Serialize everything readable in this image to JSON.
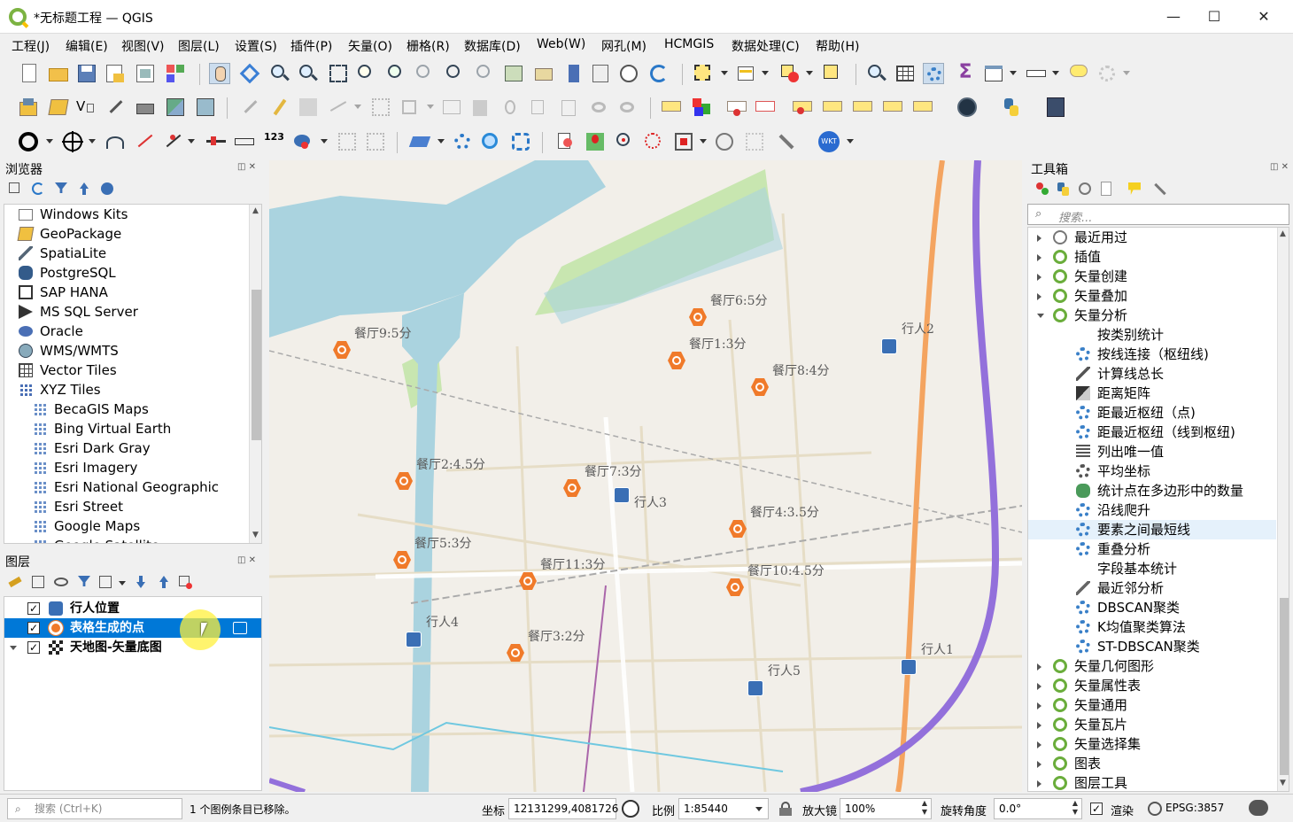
{
  "window": {
    "title": "*无标题工程 — QGIS",
    "min": "—",
    "max": "☐",
    "close": "✕"
  },
  "menu": [
    "工程(J)",
    "编辑(E)",
    "视图(V)",
    "图层(L)",
    "设置(S)",
    "插件(P)",
    "矢量(O)",
    "栅格(R)",
    "数据库(D)",
    "Web(W)",
    "网孔(M)",
    "HCMGIS",
    "数据处理(C)",
    "帮助(H)"
  ],
  "browser": {
    "title": "浏览器",
    "items": [
      {
        "label": "Windows Kits",
        "icon": "folder-icon",
        "expand": "right",
        "indent": 0
      },
      {
        "label": "GeoPackage",
        "icon": "geopackage-icon",
        "expand": "",
        "indent": 0
      },
      {
        "label": "SpatiaLite",
        "icon": "spatialite-icon",
        "expand": "",
        "indent": 0
      },
      {
        "label": "PostgreSQL",
        "icon": "postgresql-icon",
        "expand": "",
        "indent": 0
      },
      {
        "label": "SAP HANA",
        "icon": "sap-hana-icon",
        "expand": "",
        "indent": 0
      },
      {
        "label": "MS SQL Server",
        "icon": "mssql-icon",
        "expand": "",
        "indent": 0
      },
      {
        "label": "Oracle",
        "icon": "oracle-icon",
        "expand": "",
        "indent": 0
      },
      {
        "label": "WMS/WMTS",
        "icon": "wms-icon",
        "expand": "",
        "indent": 0
      },
      {
        "label": "Vector Tiles",
        "icon": "vector-tiles-icon",
        "expand": "",
        "indent": 0
      },
      {
        "label": "XYZ Tiles",
        "icon": "xyz-tiles-icon",
        "expand": "down",
        "indent": 0
      },
      {
        "label": "BecaGIS Maps",
        "icon": "tile-grid-icon",
        "expand": "",
        "indent": 1
      },
      {
        "label": "Bing Virtual Earth",
        "icon": "tile-grid-icon",
        "expand": "",
        "indent": 1
      },
      {
        "label": "Esri Dark Gray",
        "icon": "tile-grid-icon",
        "expand": "",
        "indent": 1
      },
      {
        "label": "Esri Imagery",
        "icon": "tile-grid-icon",
        "expand": "",
        "indent": 1
      },
      {
        "label": "Esri National Geographic",
        "icon": "tile-grid-icon",
        "expand": "",
        "indent": 1
      },
      {
        "label": "Esri Street",
        "icon": "tile-grid-icon",
        "expand": "",
        "indent": 1
      },
      {
        "label": "Google Maps",
        "icon": "tile-grid-icon",
        "expand": "",
        "indent": 1
      },
      {
        "label": "Google Satellite",
        "icon": "tile-grid-icon",
        "expand": "",
        "indent": 1
      }
    ]
  },
  "layers": {
    "title": "图层",
    "items": [
      {
        "label": "行人位置",
        "icon": "pedestrian-icon",
        "checked": "✓",
        "selected": false,
        "expand": ""
      },
      {
        "label": "表格生成的点",
        "icon": "restaurant-point-icon",
        "checked": "✓",
        "selected": true,
        "expand": ""
      },
      {
        "label": "天地图-矢量底图",
        "icon": "checker-raster-icon",
        "checked": "✓",
        "selected": false,
        "expand": "down"
      }
    ]
  },
  "toolbox": {
    "title": "工具箱",
    "search_placeholder": "搜索...",
    "items": [
      {
        "label": "最近用过",
        "icon": "clock-icon",
        "expand": "right",
        "indent": 0
      },
      {
        "label": "插值",
        "icon": "qgis-icon",
        "expand": "right",
        "indent": 0
      },
      {
        "label": "矢量创建",
        "icon": "qgis-icon",
        "expand": "right",
        "indent": 0
      },
      {
        "label": "矢量叠加",
        "icon": "qgis-icon",
        "expand": "right",
        "indent": 0
      },
      {
        "label": "矢量分析",
        "icon": "qgis-icon",
        "expand": "down",
        "indent": 0
      },
      {
        "label": "按类别统计",
        "icon": "sigma-icon",
        "expand": "",
        "indent": 1
      },
      {
        "label": "按线连接（枢纽线)",
        "icon": "gear-icon",
        "expand": "",
        "indent": 1
      },
      {
        "label": "计算线总长",
        "icon": "line-length-icon",
        "expand": "",
        "indent": 1
      },
      {
        "label": "距离矩阵",
        "icon": "matrix-icon",
        "expand": "",
        "indent": 1
      },
      {
        "label": "距最近枢纽（点)",
        "icon": "gear-icon",
        "expand": "",
        "indent": 1
      },
      {
        "label": "距最近枢纽（线到枢纽)",
        "icon": "gear-icon",
        "expand": "",
        "indent": 1
      },
      {
        "label": "列出唯一值",
        "icon": "list-icon",
        "expand": "",
        "indent": 1
      },
      {
        "label": "平均坐标",
        "icon": "mean-coord-icon",
        "expand": "",
        "indent": 1
      },
      {
        "label": "统计点在多边形中的数量",
        "icon": "count-points-icon",
        "expand": "",
        "indent": 1
      },
      {
        "label": "沿线爬升",
        "icon": "gear-icon",
        "expand": "",
        "indent": 1
      },
      {
        "label": "要素之间最短线",
        "icon": "gear-icon",
        "expand": "",
        "indent": 1,
        "hover": true
      },
      {
        "label": "重叠分析",
        "icon": "gear-icon",
        "expand": "",
        "indent": 1
      },
      {
        "label": "字段基本统计",
        "icon": "sigma-icon",
        "expand": "",
        "indent": 1
      },
      {
        "label": "最近邻分析",
        "icon": "nearest-neighbour-icon",
        "expand": "",
        "indent": 1
      },
      {
        "label": "DBSCAN聚类",
        "icon": "gear-icon",
        "expand": "",
        "indent": 1
      },
      {
        "label": "K均值聚类算法",
        "icon": "gear-icon",
        "expand": "",
        "indent": 1
      },
      {
        "label": "ST-DBSCAN聚类",
        "icon": "gear-icon",
        "expand": "",
        "indent": 1
      },
      {
        "label": "矢量几何图形",
        "icon": "qgis-icon",
        "expand": "right",
        "indent": 0
      },
      {
        "label": "矢量属性表",
        "icon": "qgis-icon",
        "expand": "right",
        "indent": 0
      },
      {
        "label": "矢量通用",
        "icon": "qgis-icon",
        "expand": "right",
        "indent": 0
      },
      {
        "label": "矢量瓦片",
        "icon": "qgis-icon",
        "expand": "right",
        "indent": 0
      },
      {
        "label": "矢量选择集",
        "icon": "qgis-icon",
        "expand": "right",
        "indent": 0
      },
      {
        "label": "图表",
        "icon": "qgis-icon",
        "expand": "right",
        "indent": 0
      },
      {
        "label": "图层工具",
        "icon": "qgis-icon",
        "expand": "right",
        "indent": 0
      }
    ]
  },
  "map": {
    "restaurants": [
      {
        "label": "餐厅6:5分"
      },
      {
        "label": "餐厅9:5分"
      },
      {
        "label": "餐厅1:3分"
      },
      {
        "label": "餐厅8:4分"
      },
      {
        "label": "餐厅2:4.5分"
      },
      {
        "label": "餐厅7:3分"
      },
      {
        "label": "餐厅4:3.5分"
      },
      {
        "label": "餐厅5:3分"
      },
      {
        "label": "餐厅11:3分"
      },
      {
        "label": "餐厅10:4.5分"
      },
      {
        "label": "餐厅3:2分"
      }
    ],
    "pedestrians": [
      {
        "label": "行人2"
      },
      {
        "label": "行人3"
      },
      {
        "label": "行人4"
      },
      {
        "label": "行人1"
      },
      {
        "label": "行人5"
      }
    ],
    "label_color": "#5a5a5a",
    "marker_color": "#f07a2a",
    "pedestrian_color": "#3a6fb5",
    "water_color": "#aad3df",
    "park_color": "#c8e6b0",
    "trunk_road_color": "#f4a460",
    "motorway_color": "#9370db"
  },
  "status": {
    "search_placeholder": "搜索 (Ctrl+K)",
    "message": "1 个图例条目已移除。",
    "coord_label": "坐标",
    "coord_value": "12131299,4081726",
    "scale_label": "比例",
    "scale_value": "1:85440",
    "magnifier_label": "放大镜",
    "magnifier_value": "100%",
    "rotation_label": "旋转角度",
    "rotation_value": "0.0°",
    "render_label": "渲染",
    "render_checked": "✓",
    "crs": "EPSG:3857"
  }
}
